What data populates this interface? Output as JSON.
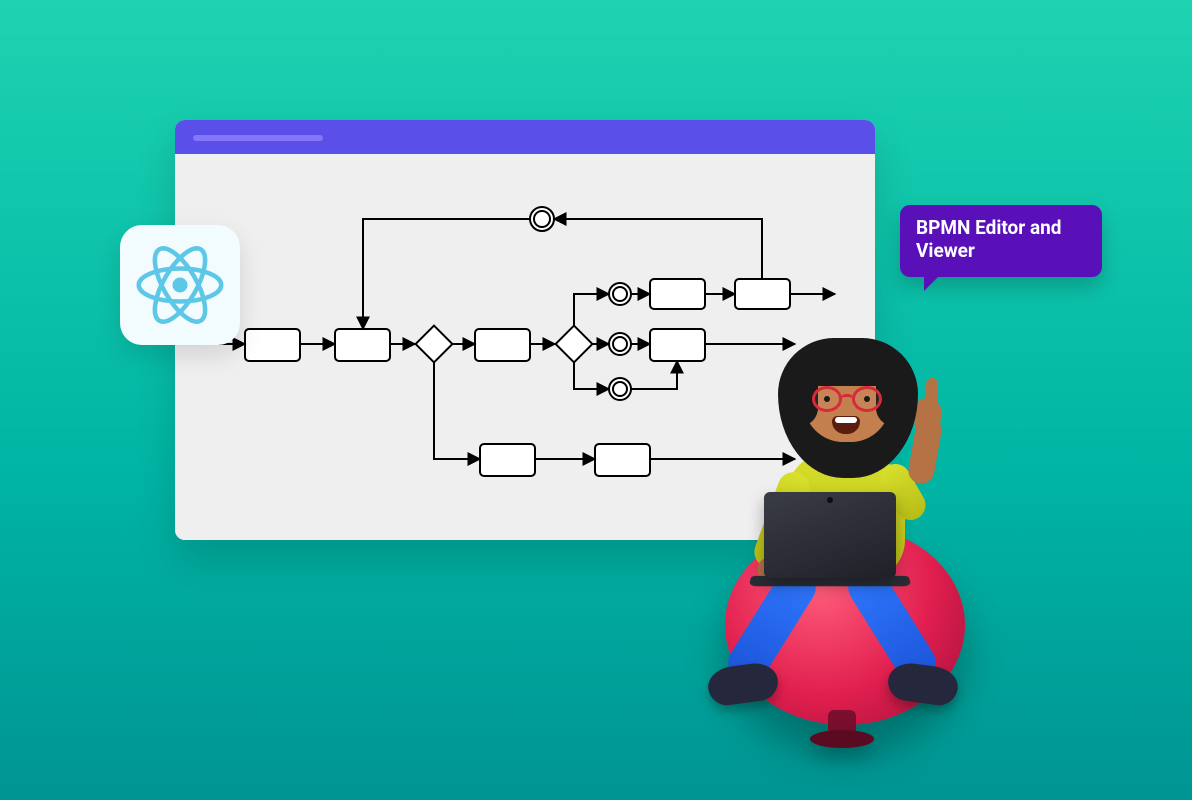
{
  "speech_bubble": {
    "text": "BPMN Editor and Viewer"
  },
  "badge": {
    "name": "react-logo"
  },
  "colors": {
    "background_top": "#1DD3B0",
    "background_bottom": "#009492",
    "window_titlebar": "#5B4FE9",
    "window_body": "#efefef",
    "speech_bg": "#5a10b8",
    "react_blue": "#5cc7e6"
  }
}
